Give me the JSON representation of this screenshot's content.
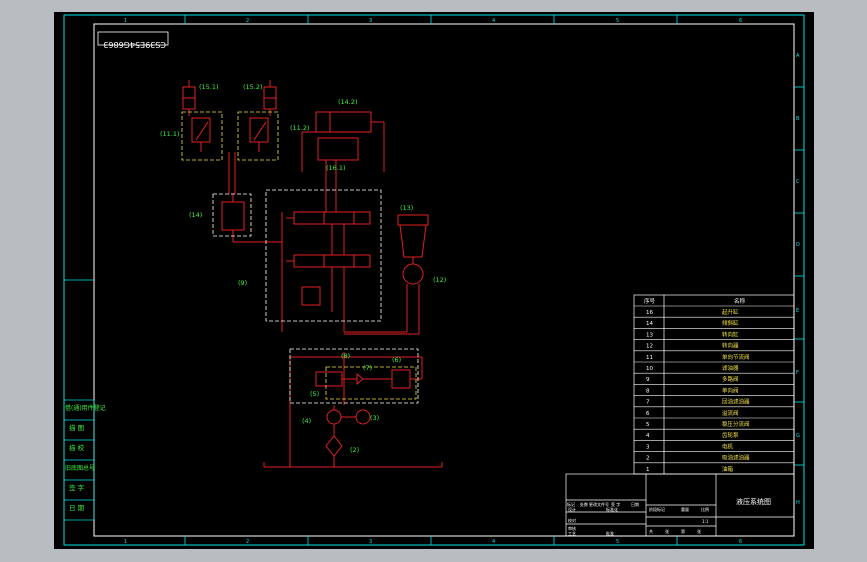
{
  "drawing": {
    "drawing_number": "CS39E54G6863",
    "column_marks": [
      "1",
      "2",
      "3",
      "4",
      "5",
      "6"
    ],
    "row_marks": [
      "A",
      "B",
      "C",
      "D",
      "E",
      "F",
      "G",
      "H"
    ],
    "title": "液压系统图"
  },
  "labels": {
    "cyl_a": "(15.1)",
    "cyl_b": "(15.2)",
    "lock": "(11.1)",
    "dir_valve": "(14.2)",
    "throttle": "(11.2)",
    "cyl_c": "(16.1)",
    "check": "(14)",
    "valve_group": "(9)",
    "tank": "(13)",
    "motor": "(12)",
    "v8": "(8)",
    "v7": "(7)",
    "v6": "(6)",
    "v5": "(5)",
    "pump": "(4)",
    "motor_e": "(3)",
    "filter": "(2)"
  },
  "parts_table": {
    "headers": [
      "序号",
      "名称"
    ],
    "rows": [
      {
        "no": "16",
        "name": "起升缸"
      },
      {
        "no": "14",
        "name": "倾斜缸"
      },
      {
        "no": "13",
        "name": "转向缸"
      },
      {
        "no": "12",
        "name": "转向器"
      },
      {
        "no": "11",
        "name": "单向节流阀"
      },
      {
        "no": "10",
        "name": "滤油器"
      },
      {
        "no": "9",
        "name": "多路阀"
      },
      {
        "no": "8",
        "name": "单向阀"
      },
      {
        "no": "7",
        "name": "回油滤油器"
      },
      {
        "no": "6",
        "name": "溢流阀"
      },
      {
        "no": "5",
        "name": "稳压分流阀"
      },
      {
        "no": "4",
        "name": "齿轮泵"
      },
      {
        "no": "3",
        "name": "电机"
      },
      {
        "no": "2",
        "name": "吸油滤油器"
      },
      {
        "no": "1",
        "name": "油箱"
      }
    ]
  },
  "side_block": [
    "借(通)用件登记",
    "描 图",
    "描 校",
    "旧底图总号",
    "签 字",
    "日 期"
  ],
  "title_block": {
    "row1": [
      "标记",
      "处数",
      "更改文件号",
      "签 字",
      "日期"
    ],
    "row2": [
      "设计",
      "标准化"
    ],
    "row3": [
      "校对"
    ],
    "row4": [
      "审核"
    ],
    "row5": [
      "工艺",
      "批准"
    ],
    "mid": [
      "阶段标记",
      "重量",
      "比例"
    ],
    "scale": "1:1",
    "sheet": [
      "共",
      "张",
      "第",
      "张"
    ]
  }
}
